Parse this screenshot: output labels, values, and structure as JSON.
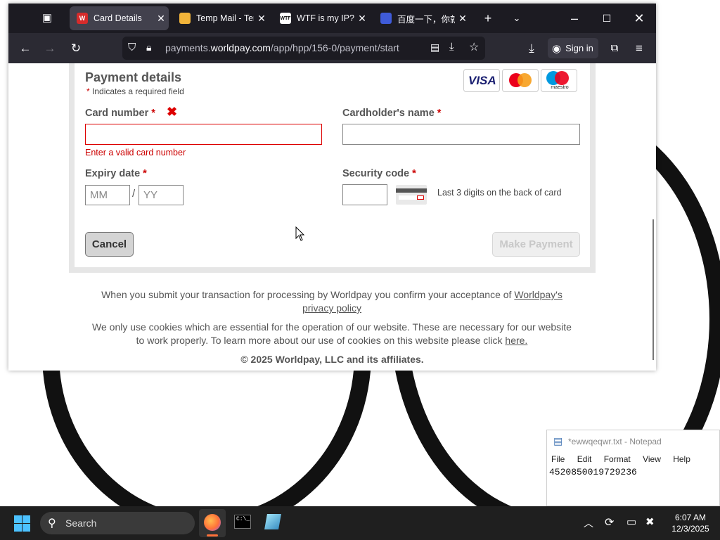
{
  "browser": {
    "tabs": [
      {
        "label": "Card Details",
        "active": true,
        "favicon": "W",
        "favicon_color": "#d62b2b"
      },
      {
        "label": "Temp Mail - Tem",
        "active": false,
        "favicon": "",
        "favicon_color": "#f2b43a"
      },
      {
        "label": "WTF is my IP?!?!",
        "active": false,
        "favicon": "WTF",
        "favicon_color": "#ffffff"
      },
      {
        "label": "百度一下，你就",
        "active": false,
        "favicon": "",
        "favicon_color": "#3f5bd8"
      }
    ],
    "url_prefix": "payments.",
    "url_domain": "worldpay.com",
    "url_path": "/app/hpp/156-0/payment/start",
    "sign_in": "Sign in"
  },
  "form": {
    "heading": "Payment details",
    "required_star": "*",
    "required_note": "Indicates a required field",
    "card_number_label": "Card number",
    "card_number_value": "",
    "card_number_error": "Enter a valid card number",
    "cardholder_label": "Cardholder's name",
    "cardholder_value": "",
    "expiry_label": "Expiry date",
    "expiry_mm_placeholder": "MM",
    "expiry_sep": "/",
    "expiry_yy_placeholder": "YY",
    "security_label": "Security code",
    "security_hint": "Last 3 digits on the back of card",
    "cancel": "Cancel",
    "make_payment": "Make Payment",
    "card_brands": [
      "VISA",
      "",
      "maestro"
    ]
  },
  "footer": {
    "privacy_text": "When you submit your transaction for processing by Worldpay you confirm your acceptance of ",
    "privacy_link": "Worldpay's privacy policy",
    "cookies_text": "We only use cookies which are essential for the operation of our website. These are necessary for our website to work properly. To learn more about our use of cookies on this website please click ",
    "cookies_link": "here.",
    "copyright": "© 2025 Worldpay, LLC and its affiliates."
  },
  "notepad": {
    "title": "*ewwqeqwr.txt - Notepad",
    "menu": [
      "File",
      "Edit",
      "Format",
      "View",
      "Help"
    ],
    "content": "4520850019729236"
  },
  "taskbar": {
    "search": "Search",
    "time": "6:07 AM",
    "date": "12/3/2025"
  },
  "colors": {
    "error": "#cc0000",
    "visa_blue": "#1a1f71",
    "mastercard_red": "#eb001b",
    "mastercard_orange": "#f79e1b",
    "maestro_blue": "#0099df"
  }
}
